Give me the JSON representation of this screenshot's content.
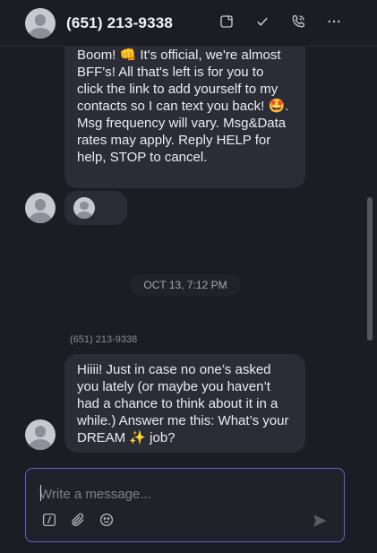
{
  "header": {
    "contact_name": "(651) 213-9338",
    "icons": [
      "add-note-icon",
      "check-icon",
      "phone-icon",
      "more-icon"
    ]
  },
  "messages": [
    {
      "text": "Boom! 👊 It's official, we're almost BFF's! All that's left is for you to click the link to add yourself to my contacts so I can text you back! 🤩. Msg frequency will vary. Msg&Data rates may apply. Reply HELP for help, STOP to cancel."
    },
    {
      "type": "contact-card"
    },
    {
      "sender": "(651) 213-9338",
      "text": "Hiiii! Just in case no one’s asked you lately (or maybe you haven’t had a chance to think about it in a while.) Answer me this: What’s your DREAM ✨ job?"
    }
  ],
  "date_divider": "OCT 13, 7:12 PM",
  "composer": {
    "placeholder": "Write a message...",
    "tools": [
      "slash-command-icon",
      "attachment-icon",
      "emoji-icon"
    ],
    "send_icon": "send-icon"
  },
  "colors": {
    "background": "#1c1c24",
    "bubble": "#2c2c37",
    "accent": "#6d5bd0"
  }
}
